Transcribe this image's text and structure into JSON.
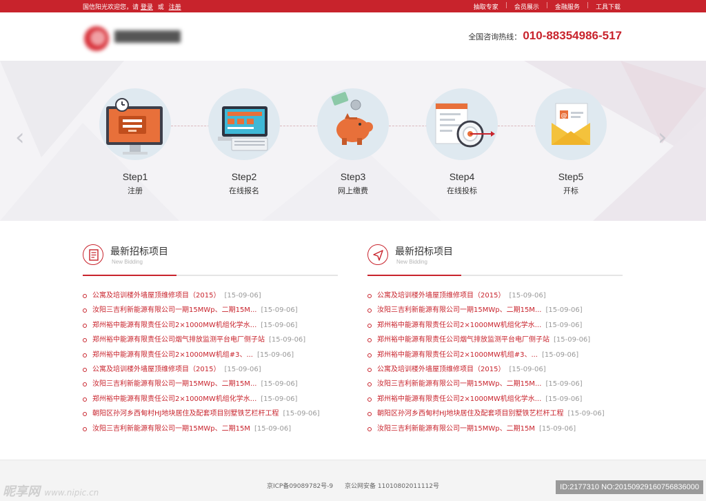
{
  "topbar": {
    "welcome": "国信阳光欢迎您，请",
    "login": "登录",
    "or": "或",
    "register": "注册",
    "links": [
      "抽取专家",
      "会员展示",
      "金融服务",
      "工具下载"
    ]
  },
  "header": {
    "hotline_label": "全国咨询热线：",
    "hotline_number": "010-88354986-517"
  },
  "steps": [
    {
      "title": "Step1",
      "label": "注册",
      "icon": "computer-login-icon"
    },
    {
      "title": "Step2",
      "label": "在线报名",
      "icon": "laptop-form-icon"
    },
    {
      "title": "Step3",
      "label": "网上缴费",
      "icon": "piggy-bank-icon"
    },
    {
      "title": "Step4",
      "label": "在线投标",
      "icon": "target-document-icon"
    },
    {
      "title": "Step5",
      "label": "开标",
      "icon": "envelope-icon"
    }
  ],
  "lists": {
    "left": {
      "title": "最新招标项目",
      "subtitle": "New Bidding",
      "icon": "document-list-icon",
      "items": [
        {
          "title": "公寓及培训楼外墙屋顶维修项目（2015）",
          "date": "[15-09-06]"
        },
        {
          "title": "汝阳三吉利新能源有限公司一期15MWp、二期15M...",
          "date": "[15-09-06]"
        },
        {
          "title": "郑州裕中能源有限责任公司2×1000MW机组化学水...",
          "date": "[15-09-06]"
        },
        {
          "title": "郑州裕中能源有限责任公司烟气排放监测平台电厂侧子站",
          "date": "[15-09-06]"
        },
        {
          "title": "郑州裕中能源有限责任公司2×1000MW机组#3、...",
          "date": "[15-09-06]"
        },
        {
          "title": "公寓及培训楼外墙屋顶维修项目（2015）",
          "date": "[15-09-06]"
        },
        {
          "title": "汝阳三吉利新能源有限公司一期15MWp、二期15M...",
          "date": "[15-09-06]"
        },
        {
          "title": "郑州裕中能源有限责任公司2×1000MW机组化学水...",
          "date": "[15-09-06]"
        },
        {
          "title": "朝阳区孙河乡西甸村HJ地块居住及配套项目别墅铁艺栏杆工程",
          "date": "[15-09-06]"
        },
        {
          "title": "汝阳三吉利新能源有限公司一期15MWp、二期15M",
          "date": "[15-09-06]"
        }
      ]
    },
    "right": {
      "title": "最新招标项目",
      "subtitle": "New Bidding",
      "icon": "navigation-arrow-icon",
      "items": [
        {
          "title": "公寓及培训楼外墙屋顶维修项目（2015）",
          "date": "[15-09-06]"
        },
        {
          "title": "汝阳三吉利新能源有限公司一期15MWp、二期15M...",
          "date": "[15-09-06]"
        },
        {
          "title": "郑州裕中能源有限责任公司2×1000MW机组化学水...",
          "date": "[15-09-06]"
        },
        {
          "title": "郑州裕中能源有限责任公司烟气排放监测平台电厂侧子站",
          "date": "[15-09-06]"
        },
        {
          "title": "郑州裕中能源有限责任公司2×1000MW机组#3、...",
          "date": "[15-09-06]"
        },
        {
          "title": "公寓及培训楼外墙屋顶维修项目（2015）",
          "date": "[15-09-06]"
        },
        {
          "title": "汝阳三吉利新能源有限公司一期15MWp、二期15M...",
          "date": "[15-09-06]"
        },
        {
          "title": "郑州裕中能源有限责任公司2×1000MW机组化学水...",
          "date": "[15-09-06]"
        },
        {
          "title": "朝阳区孙河乡西甸村HJ地块居住及配套项目别墅铁艺栏杆工程",
          "date": "[15-09-06]"
        },
        {
          "title": "汝阳三吉利新能源有限公司一期15MWp、二期15M",
          "date": "[15-09-06]"
        }
      ]
    }
  },
  "footer": {
    "icp": "京ICP备09089782号-9",
    "security": "京公网安备 11010802011112号"
  },
  "watermark": {
    "brand": "昵享网",
    "url": "www.nipic.cn",
    "id_text": "ID:2177310 NO:20150929160756836000"
  },
  "colors": {
    "brand_red": "#c8232c",
    "banner_bg": "#f4f3f6",
    "circle_bg": "#dfe9f0"
  }
}
